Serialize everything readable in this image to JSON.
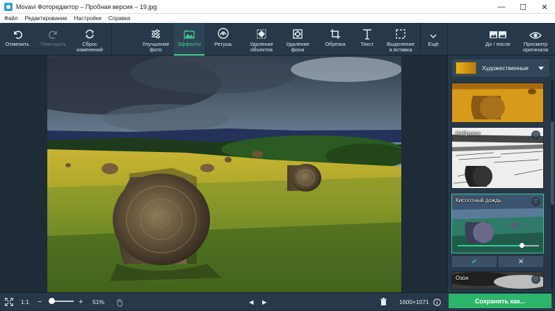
{
  "window": {
    "title": "Movavi Фоторедактор – Пробная версия – 19.jpg",
    "minimize": "—",
    "maximize": "☐",
    "close": "✕"
  },
  "menu": [
    "Файл",
    "Редактирование",
    "Настройки",
    "Справка"
  ],
  "toolbar": {
    "undo": "Отменить",
    "redo": "Повторить",
    "reset": "Сброс\nизменений",
    "enhance": "Улучшение\nфото",
    "effects": "Эффекты",
    "retouch": "Ретушь",
    "remove_objects": "Удаление\nобъектов",
    "remove_bg": "Удаление\nфона",
    "crop": "Обрезка",
    "text": "Текст",
    "select": "Выделение\nи вставка",
    "more": "Ещё",
    "before_after": "До / после",
    "view_original": "Просмотр\nоригинала"
  },
  "panel": {
    "category": "Художественные",
    "effects": [
      {
        "name": ""
      },
      {
        "name": "Набросок"
      },
      {
        "name": "Кислотный дождь",
        "selected": true,
        "intensity": 0.79
      },
      {
        "name": "Озон"
      }
    ],
    "ok_icon": "✔",
    "cancel_icon": "✕"
  },
  "statusbar": {
    "fit_icon": "fit-screen-icon",
    "actual_size": "1:1",
    "zoom_out": "−",
    "zoom_in": "+",
    "zoom": "51%",
    "zoom_level": 0.1,
    "prev": "◀",
    "next": "▶",
    "dimensions": "1600×1071",
    "save": "Сохранить как..."
  },
  "colors": {
    "accent": "#3ec98f",
    "save": "#2cb56b",
    "toolbar_bg": "#27384a",
    "workspace_bg": "#1f2b37"
  }
}
